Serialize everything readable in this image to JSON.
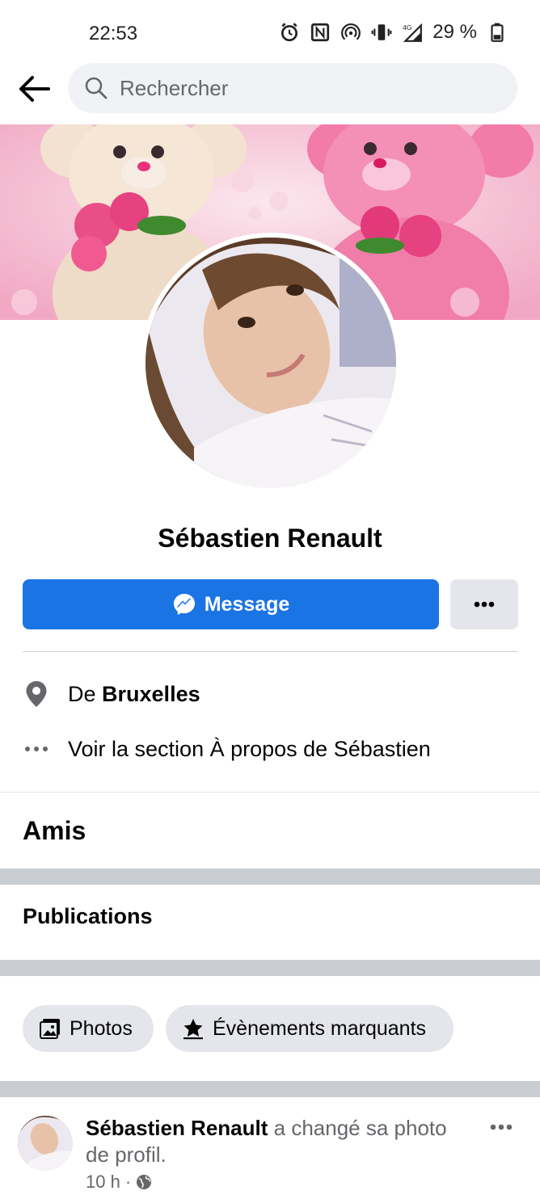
{
  "status_bar": {
    "time": "22:53",
    "battery": "29 %",
    "network": "4G",
    "icons": [
      "alarm-icon",
      "nfc-icon",
      "hotspot-icon",
      "vibrate-icon",
      "signal-icon",
      "battery-icon"
    ]
  },
  "header": {
    "back_icon": "arrow-left-icon",
    "search_placeholder": "Rechercher"
  },
  "profile": {
    "name": "Sébastien Renault",
    "message_label": "Message",
    "more_label": "•••"
  },
  "details": {
    "location_prefix": "De",
    "location_city": "Bruxelles",
    "about_link": "Voir la section À propos de Sébastien",
    "about_icon_text": "•••"
  },
  "sections": {
    "friends_title": "Amis",
    "posts_title": "Publications"
  },
  "chips": {
    "photos": "Photos",
    "highlights": "Évènements marquants"
  },
  "post": {
    "author": "Sébastien Renault",
    "action": " a changé sa photo de profil.",
    "time": "10 h",
    "separator": "·",
    "more_label": "•••"
  },
  "colors": {
    "accent": "#1b74e4",
    "secondary_button": "#e4e6eb",
    "separator": "#c9ccd1",
    "muted_text": "#65676b"
  }
}
